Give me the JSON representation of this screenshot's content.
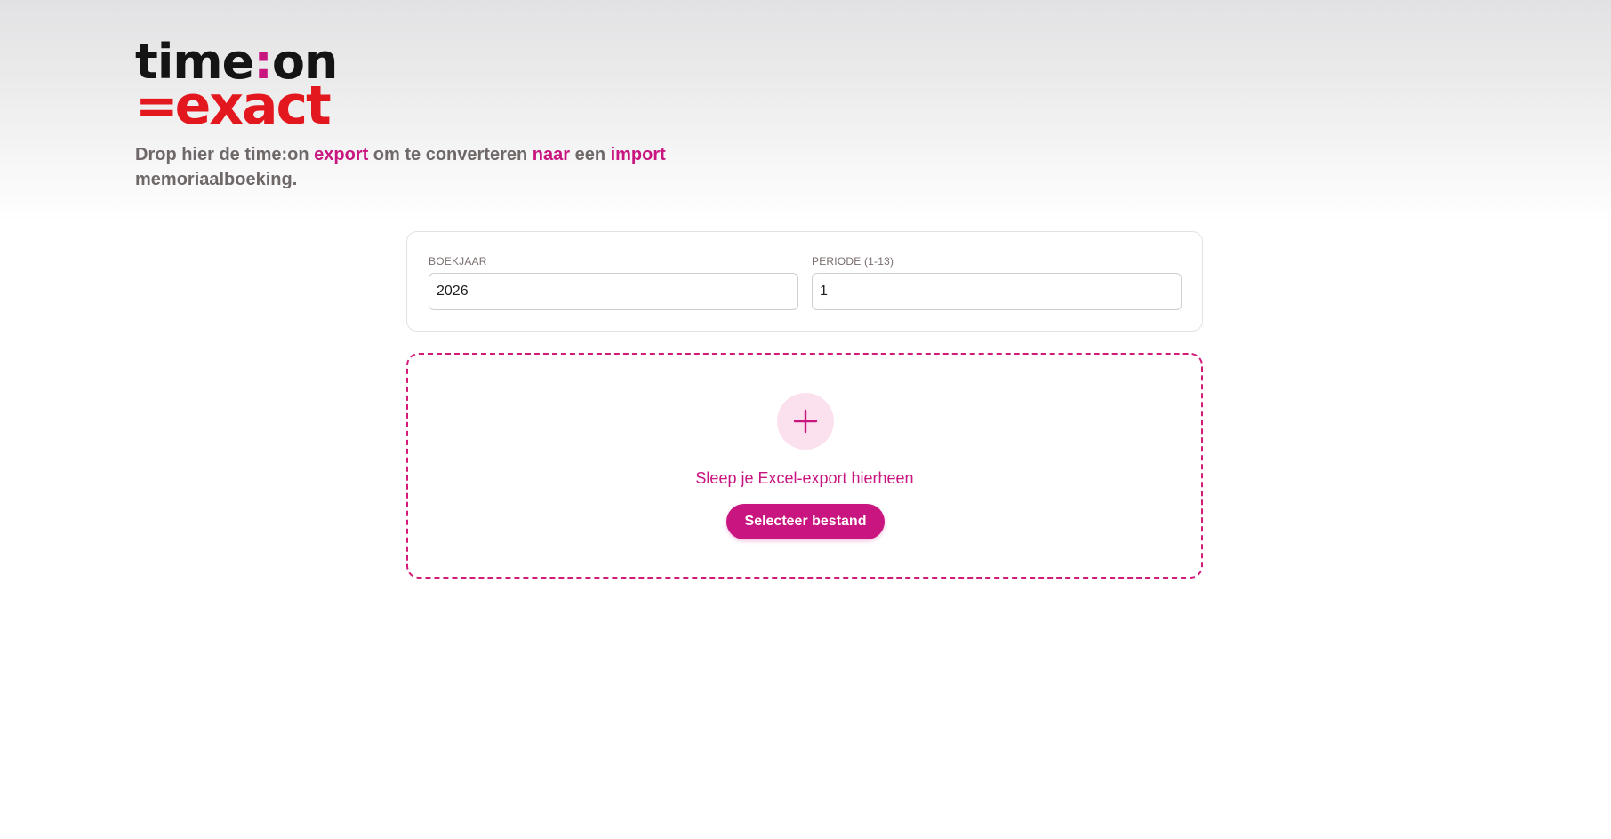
{
  "logo": {
    "line1_a": "time",
    "line1_colon": ":",
    "line1_b": "on",
    "line2_eq": "=",
    "line2_word": "exact"
  },
  "tagline": {
    "part1": "Drop hier de time:on ",
    "hl1": "export",
    "part2": " om te converteren ",
    "hl2": "naar",
    "part3": " een ",
    "hl3": "import",
    "part4": " memoriaalboeking."
  },
  "settings": {
    "boekjaar_label": "BOEKJAAR",
    "boekjaar_value": "2026",
    "periode_label": "PERIODE (1-13)",
    "periode_value": "1"
  },
  "dropzone": {
    "icon": "plus-icon",
    "text": "Sleep je Excel-export hierheen",
    "button_label": "Selecteer bestand"
  },
  "colors": {
    "accent": "#c8157f",
    "brand_red": "#e3181f",
    "plus_bg": "#fbe1ee",
    "text_gray": "#6f6868"
  }
}
